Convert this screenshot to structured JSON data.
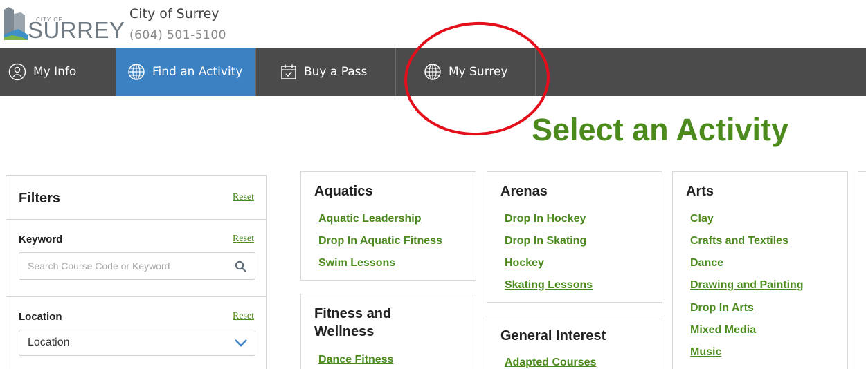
{
  "header": {
    "org_name": "City of Surrey",
    "phone": "(604) 501-5100",
    "logo_text": "CITY OF SURREY"
  },
  "nav": {
    "items": [
      {
        "label": "My Info",
        "icon": "person-icon",
        "active": false
      },
      {
        "label": "Find an Activity",
        "icon": "globe-icon",
        "active": true
      },
      {
        "label": "Buy a Pass",
        "icon": "calendar-check-icon",
        "active": false
      },
      {
        "label": "My Surrey",
        "icon": "globe-icon",
        "active": false
      }
    ]
  },
  "page": {
    "title": "Select an Activity"
  },
  "filters": {
    "title": "Filters",
    "reset_label": "Reset",
    "keyword": {
      "label": "Keyword",
      "reset_label": "Reset",
      "value": "",
      "placeholder": "Search Course Code or Keyword"
    },
    "location": {
      "label": "Location",
      "reset_label": "Reset",
      "selected": "Location"
    }
  },
  "categories": {
    "aquatics": {
      "title": "Aquatics",
      "items": [
        "Aquatic Leadership",
        "Drop In Aquatic Fitness",
        "Swim Lessons"
      ]
    },
    "fitness": {
      "title_line1": "Fitness and",
      "title_line2": "Wellness",
      "items": [
        "Dance Fitness"
      ]
    },
    "arenas": {
      "title": "Arenas",
      "items": [
        "Drop In Hockey",
        "Drop In Skating",
        "Hockey",
        "Skating Lessons"
      ]
    },
    "general": {
      "title": "General Interest",
      "items": [
        "Adapted Courses"
      ]
    },
    "arts": {
      "title": "Arts",
      "items": [
        "Clay",
        "Crafts and Textiles",
        "Dance",
        "Drawing and Painting",
        "Drop In Arts",
        "Mixed Media",
        "Music"
      ]
    }
  },
  "colors": {
    "nav_bg": "#4b4b4b",
    "nav_active": "#3c82c3",
    "accent_green": "#4c8a1e",
    "highlight_red": "#e3101b"
  }
}
